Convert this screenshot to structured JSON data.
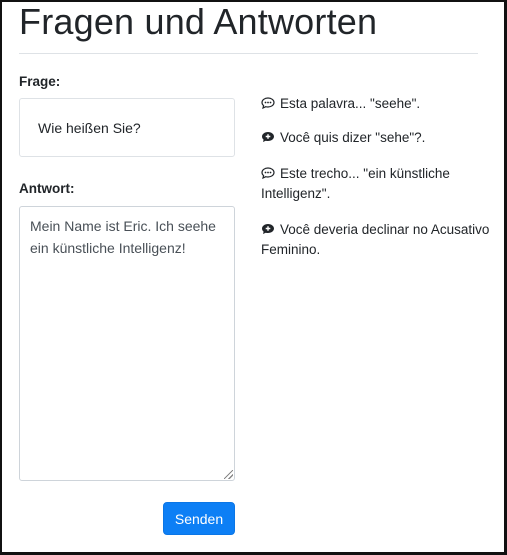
{
  "page": {
    "title": "Fragen und Antworten"
  },
  "question": {
    "label": "Frage:",
    "text": "Wie heißen Sie?"
  },
  "answer": {
    "label": "Antwort:",
    "value": "Mein Name ist Eric. Ich seehe ein künstliche Intelligenz!"
  },
  "actions": {
    "send_label": "Senden"
  },
  "feedback": {
    "items": [
      {
        "icon": "chat-dots-icon",
        "text": "Esta palavra... \"seehe\"."
      },
      {
        "icon": "chat-plus-icon",
        "text": "Você quis dizer \"sehe\"?."
      },
      {
        "icon": "chat-dots-icon",
        "text": "Este trecho... \"ein künstliche Intelligenz\"."
      },
      {
        "icon": "chat-plus-icon",
        "text": "Você deveria declinar no Acusativo Feminino."
      }
    ]
  },
  "colors": {
    "primary": "#0d7ff5",
    "text": "#212529",
    "border": "#dee2e6"
  }
}
